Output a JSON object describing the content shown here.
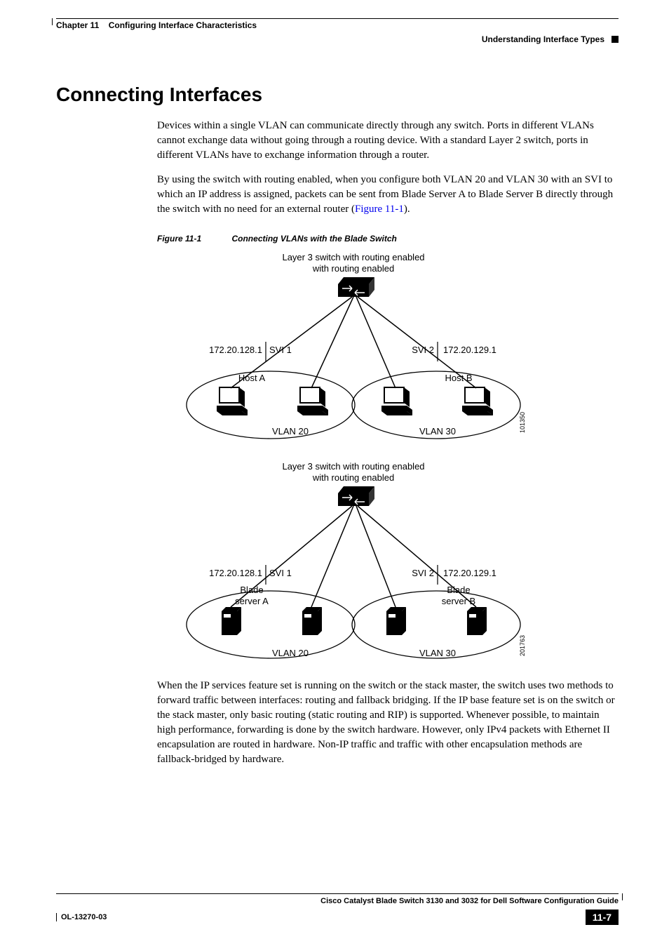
{
  "header": {
    "chapter_label": "Chapter 11",
    "chapter_title": "Configuring Interface Characteristics",
    "section_breadcrumb": "Understanding Interface Types"
  },
  "section": {
    "title": "Connecting Interfaces",
    "p1": "Devices within a single VLAN can communicate directly through any switch. Ports in different VLANs cannot exchange data without going through a routing device. With a standard Layer 2 switch, ports in different VLANs have to exchange information through a router.",
    "p2_pre": "By using the switch with routing enabled, when you configure both VLAN 20 and VLAN 30 with an SVI to which an IP address is assigned, packets can be sent from Blade Server A to Blade Server B directly through the switch with no need for an external router (",
    "p2_link": "Figure 11-1",
    "p2_post": ").",
    "p3": "When the IP services feature set is running on the switch or the stack master, the switch uses two methods to forward traffic between interfaces: routing and fallback bridging. If the IP base feature set is on the switch or the stack master, only basic routing (static routing and RIP) is supported. Whenever possible, to maintain high performance, forwarding is done by the switch hardware. However, only IPv4 packets with Ethernet II encapsulation are routed in hardware. Non-IP traffic and traffic with other encapsulation methods are fallback-bridged by hardware."
  },
  "figure": {
    "number": "Figure 11-1",
    "caption": "Connecting VLANs with the Blade Switch"
  },
  "chart_data": [
    {
      "type": "diagram",
      "title": "Layer 3 switch with routing enabled",
      "image_id": "101350",
      "svis": [
        {
          "name": "SVI 1",
          "ip": "172.20.128.1",
          "vlan": "VLAN 20",
          "host": "Host A"
        },
        {
          "name": "SVI 2",
          "ip": "172.20.129.1",
          "vlan": "VLAN 30",
          "host": "Host B"
        }
      ]
    },
    {
      "type": "diagram",
      "title": "Layer 3 switch with routing enabled",
      "image_id": "201763",
      "svis": [
        {
          "name": "SVI 1",
          "ip": "172.20.128.1",
          "vlan": "VLAN 20",
          "host": "Blade server A"
        },
        {
          "name": "SVI 2",
          "ip": "172.20.129.1",
          "vlan": "VLAN 30",
          "host": "Blade server B"
        }
      ]
    }
  ],
  "footer": {
    "book_title": "Cisco Catalyst Blade Switch 3130 and 3032 for Dell Software Configuration Guide",
    "doc_id": "OL-13270-03",
    "page_num": "11-7"
  }
}
